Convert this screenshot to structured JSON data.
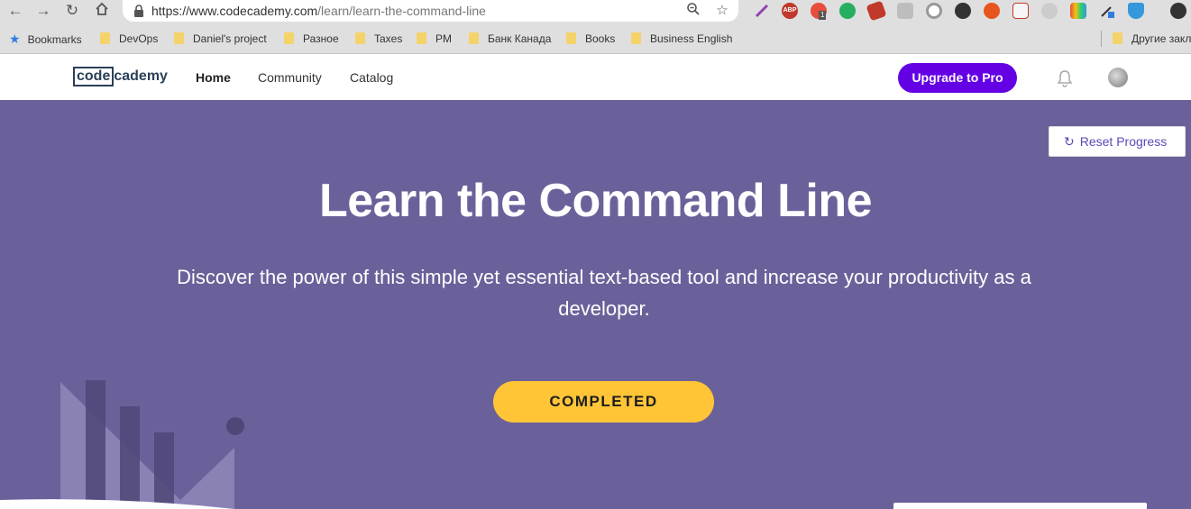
{
  "browser": {
    "url_domain": "https://www.codecademy.com",
    "url_path": "/learn/learn-the-command-line",
    "bookmarks": [
      {
        "label": "Bookmarks"
      },
      {
        "label": "DevOps"
      },
      {
        "label": "Daniel's project"
      },
      {
        "label": "Разное"
      },
      {
        "label": "Taxes"
      },
      {
        "label": "PM"
      },
      {
        "label": "Банк Канада"
      },
      {
        "label": "Books"
      },
      {
        "label": "Business English"
      },
      {
        "label": "Другие закл"
      }
    ],
    "extension_badge": "1",
    "extension_abp_label": "ABP"
  },
  "header": {
    "logo_box": "code",
    "logo_rest": "cademy",
    "nav": [
      {
        "label": "Home",
        "active": true
      },
      {
        "label": "Community",
        "active": false
      },
      {
        "label": "Catalog",
        "active": false
      }
    ],
    "upgrade_label": "Upgrade to Pro"
  },
  "hero": {
    "reset_label": "Reset Progress",
    "title": "Learn the Command Line",
    "description": "Discover the power of this simple yet essential text-based tool and increase your productivity as a developer.",
    "status_label": "COMPLETED"
  },
  "colors": {
    "hero_bg": "#6b619a",
    "brand_purple": "#6400e4",
    "completed_yellow": "#ffc537"
  }
}
